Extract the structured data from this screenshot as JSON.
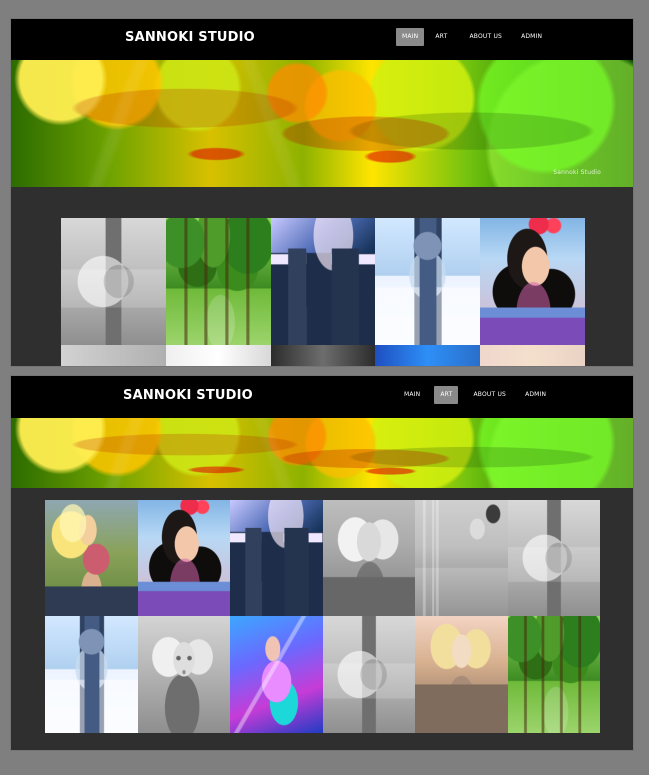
{
  "captures": [
    {
      "brand": "SANNOKI STUDIO",
      "nav": [
        "MAIN",
        "ART",
        "ABOUT US",
        "ADMIN"
      ],
      "active_nav": "MAIN",
      "banner_watermark": "Sannoki Studio",
      "gallery": [
        {
          "name": "gray-cliff-art",
          "style": "light-gray"
        },
        {
          "name": "green-forest-art",
          "style": "forest"
        },
        {
          "name": "night-arch-art",
          "style": "arch"
        },
        {
          "name": "snow-knight-art",
          "style": "sky-snow"
        },
        {
          "name": "dark-haired-woman-art",
          "style": "portrait-dark"
        },
        {
          "name": "grey-strip-art",
          "style": "strip-grey"
        },
        {
          "name": "white-strip-art",
          "style": "strip-white"
        },
        {
          "name": "dark-strip-art",
          "style": "strip-dark"
        },
        {
          "name": "blue-strip-art",
          "style": "strip-blue"
        },
        {
          "name": "pink-strip-art",
          "style": "strip-pink"
        }
      ]
    },
    {
      "brand": "SANNOKI STUDIO",
      "nav": [
        "MAIN",
        "ART",
        "ABOUT US",
        "ADMIN"
      ],
      "active_nav": "ART",
      "gallery": [
        {
          "name": "blonde-farmer-art",
          "style": "blonde"
        },
        {
          "name": "dark-haired-woman-art",
          "style": "portrait-dark"
        },
        {
          "name": "night-arch-art",
          "style": "arch"
        },
        {
          "name": "silver-hair-woman-art",
          "style": "silver-hair"
        },
        {
          "name": "lab-tubes-art",
          "style": "tube-room"
        },
        {
          "name": "stone-room-art",
          "style": "light-gray"
        },
        {
          "name": "snow-knight-art",
          "style": "sky-snow"
        },
        {
          "name": "gray-face-art",
          "style": "gray-face"
        },
        {
          "name": "mermaid-art",
          "style": "mermaid"
        },
        {
          "name": "gray-cliff-art",
          "style": "light-gray"
        },
        {
          "name": "blonde-armor-art",
          "style": "blonde-armor"
        },
        {
          "name": "green-forest-art",
          "style": "forest"
        }
      ]
    }
  ]
}
